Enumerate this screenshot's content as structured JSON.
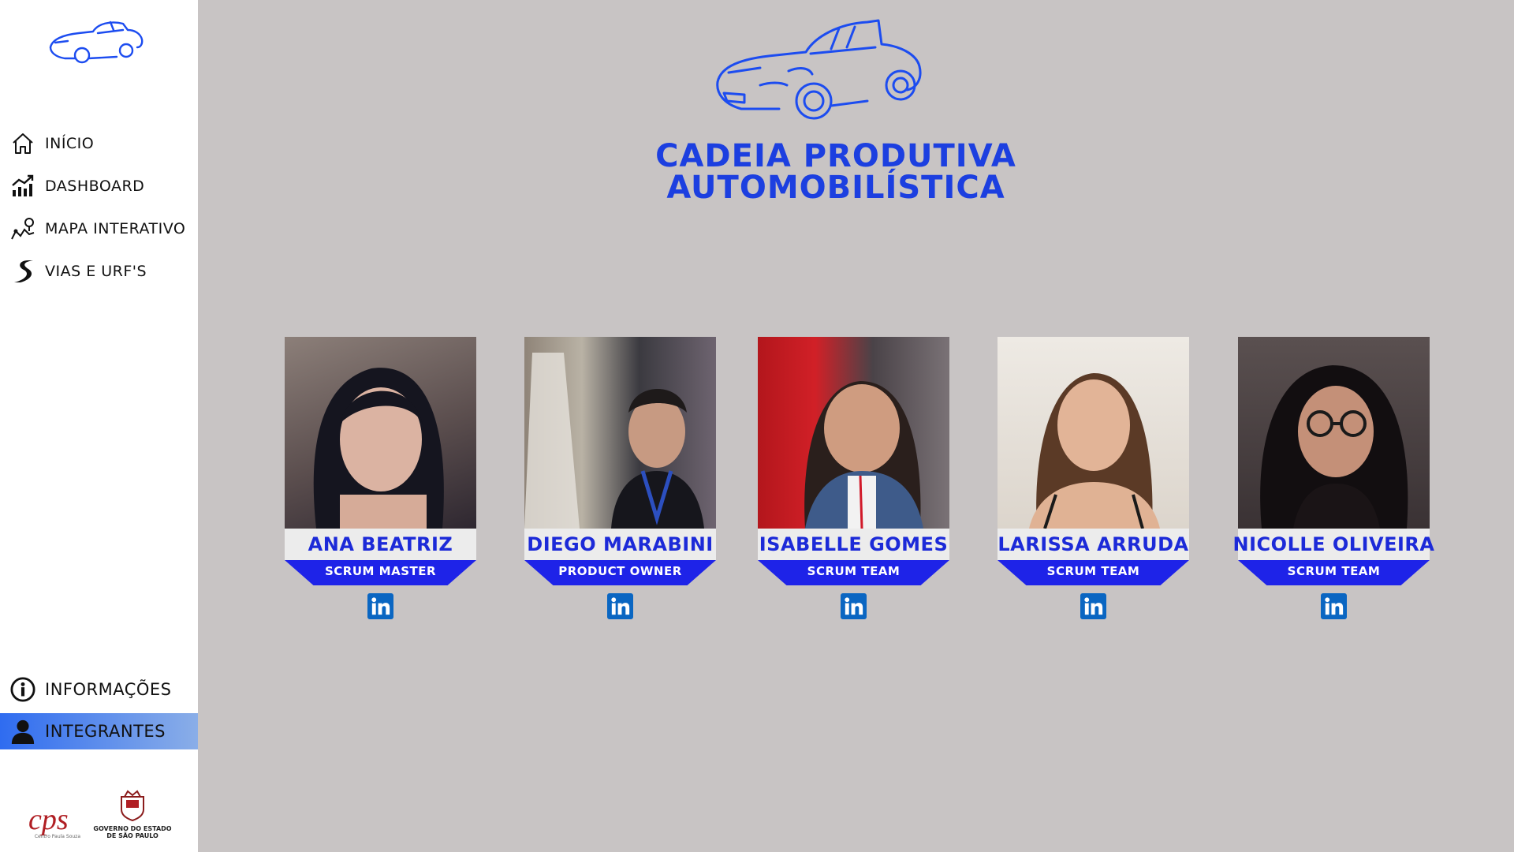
{
  "sidebar": {
    "logo_icon": "car-logo-icon",
    "nav": [
      {
        "label": "INÍCIO",
        "icon": "home-icon"
      },
      {
        "label": "DASHBOARD",
        "icon": "chart-trend-icon"
      },
      {
        "label": "MAPA INTERATIVO",
        "icon": "map-pin-icon"
      },
      {
        "label": "VIAS E URF'S",
        "icon": "road-icon"
      }
    ],
    "bottom_nav": [
      {
        "label": "INFORMAÇÕES",
        "icon": "info-icon"
      },
      {
        "label": "INTEGRANTES",
        "icon": "person-icon",
        "active": true
      }
    ],
    "sponsors": {
      "cps_logo": "cps",
      "cps_caption": "Centro Paula Souza",
      "gov_caption_line1": "GOVERNO DO ESTADO",
      "gov_caption_line2": "DE SÃO PAULO"
    }
  },
  "header": {
    "title_line1": "CADEIA PRODUTIVA",
    "title_line2": "AUTOMOBILÍSTICA"
  },
  "team": [
    {
      "name": "ANA BEATRIZ",
      "role": "SCRUM MASTER"
    },
    {
      "name": "DIEGO MARABINI",
      "role": "PRODUCT OWNER"
    },
    {
      "name": "ISABELLE GOMES",
      "role": "SCRUM TEAM"
    },
    {
      "name": "LARISSA ARRUDA",
      "role": "SCRUM TEAM"
    },
    {
      "name": "NICOLLE OLIVEIRA",
      "role": "SCRUM TEAM"
    }
  ],
  "colors": {
    "accent_blue": "#1c3fe0",
    "role_blue": "#1e23e8",
    "background": "#c8c4c4",
    "linkedin": "#0a66c2"
  }
}
